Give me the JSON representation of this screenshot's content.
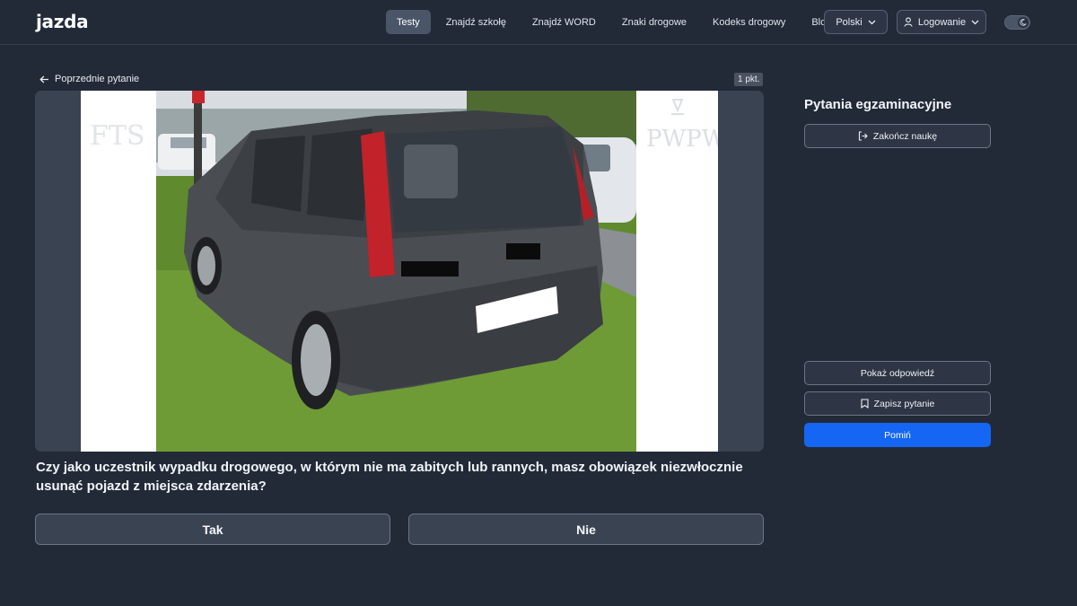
{
  "header": {
    "logo_text": "jazda",
    "nav": [
      {
        "label": "Testy",
        "active": true
      },
      {
        "label": "Znajdź szkołę",
        "active": false
      },
      {
        "label": "Znajdź WORD",
        "active": false
      },
      {
        "label": "Znaki drogowe",
        "active": false
      },
      {
        "label": "Kodeks drogowy",
        "active": false
      },
      {
        "label": "Blog",
        "active": false
      }
    ],
    "language_label": "Polski",
    "login_label": "Logowanie",
    "theme_toggle_icon": "moon-icon"
  },
  "main": {
    "back_label": "Poprzednie pytanie",
    "points_badge": "1 pkt.",
    "question": "Czy jako uczestnik wypadku drogowego, w którym nie ma zabitych lub rannych, masz obowiązek niezwłocznie usunąć pojazd z miejsca zdarzenia?",
    "answers": [
      "Tak",
      "Nie"
    ],
    "image_watermark_right": "PWPW"
  },
  "sidebar": {
    "title": "Pytania egzaminacyjne",
    "end_label": "Zakończ naukę",
    "show_answer_label": "Pokaż odpowiedź",
    "save_label": "Zapisz pytanie",
    "skip_label": "Pomiń"
  },
  "colors": {
    "background": "#222a38",
    "primary": "#1566f2",
    "active_nav": "#4a5568"
  }
}
